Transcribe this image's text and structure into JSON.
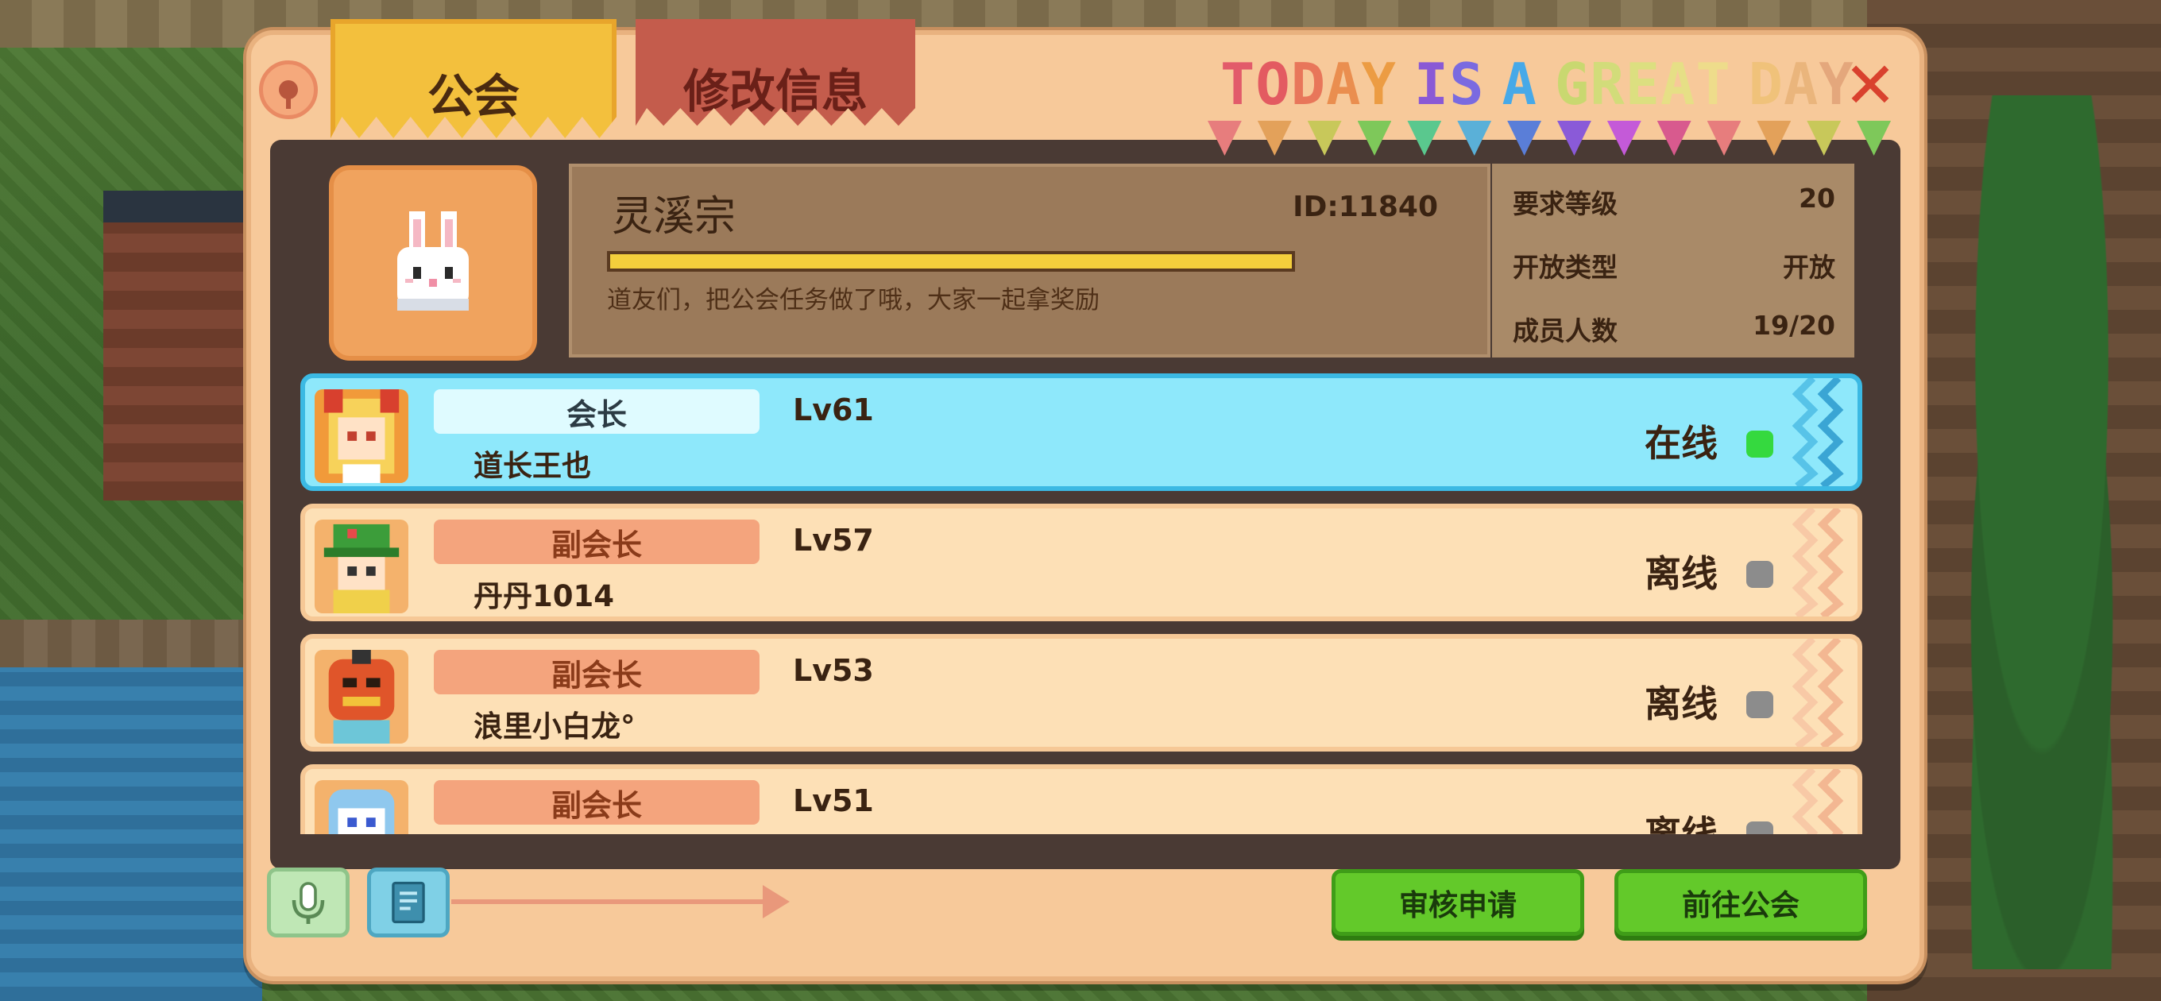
{
  "panel": {
    "tabs": [
      {
        "label": "公会",
        "active": true
      },
      {
        "label": "修改信息",
        "active": false
      }
    ],
    "banner": {
      "letters": [
        {
          "ch": "T",
          "color": "#e25b6a"
        },
        {
          "ch": "O",
          "color": "#e35a61"
        },
        {
          "ch": "D",
          "color": "#e8765a"
        },
        {
          "ch": "A",
          "color": "#ea8e4f"
        },
        {
          "ch": "Y",
          "color": "#ec9c43"
        },
        {
          "ch": " ",
          "color": "#000000"
        },
        {
          "ch": "I",
          "color": "#8a59d5"
        },
        {
          "ch": "S",
          "color": "#7a6ae0"
        },
        {
          "ch": " ",
          "color": "#000000"
        },
        {
          "ch": "A",
          "color": "#47a9e8"
        },
        {
          "ch": " ",
          "color": "#000000"
        },
        {
          "ch": "G",
          "color": "#c9d870"
        },
        {
          "ch": "R",
          "color": "#d2dc7a"
        },
        {
          "ch": "E",
          "color": "#dcdf80"
        },
        {
          "ch": "A",
          "color": "#e6df86"
        },
        {
          "ch": "T",
          "color": "#eedc8b"
        },
        {
          "ch": " ",
          "color": "#000000"
        },
        {
          "ch": "D",
          "color": "#f0c27a"
        },
        {
          "ch": "A",
          "color": "#eab57c"
        },
        {
          "ch": "Y",
          "color": "#e4a77c"
        }
      ],
      "flag_colors": [
        "#e77d7d",
        "#e3a15a",
        "#c8c85a",
        "#7ec85a",
        "#5ac88e",
        "#5ab0d8",
        "#5a7ed8",
        "#8a5ad8",
        "#c45ad8",
        "#d85a8e",
        "#e77d7d",
        "#e3a15a",
        "#c8c85a",
        "#7ec85a"
      ]
    },
    "close_icon": "close-icon",
    "help_icon": "help-icon"
  },
  "guild": {
    "avatar_icon": "rabbit-icon",
    "name": "灵溪宗",
    "id_text": "ID:11840",
    "notice": "道友们，把公会任务做了哦，大家一起拿奖励",
    "stats": [
      {
        "label": "要求等级",
        "value": "20"
      },
      {
        "label": "开放类型",
        "value": "开放"
      },
      {
        "label": "成员人数",
        "value": "19/20"
      }
    ]
  },
  "members": [
    {
      "role": "会长",
      "name": "道长王也",
      "level": "Lv61",
      "status": "在线",
      "online": true,
      "avatar_icon": "fox-girl-avatar"
    },
    {
      "role": "副会长",
      "name": "丹丹1014",
      "level": "Lv57",
      "status": "离线",
      "online": false,
      "avatar_icon": "green-hat-avatar"
    },
    {
      "role": "副会长",
      "name": "浪里小白龙°",
      "level": "Lv53",
      "status": "离线",
      "online": false,
      "avatar_icon": "pumpkin-avatar"
    },
    {
      "role": "副会长",
      "name": "",
      "level": "Lv51",
      "status": "离线",
      "online": false,
      "avatar_icon": "blue-robot-avatar"
    }
  ],
  "bottom": {
    "mic_icon": "microphone-icon",
    "book_icon": "book-icon",
    "buttons": {
      "review": "审核申请",
      "goto_guild": "前往公会"
    }
  },
  "colors": {
    "online": "#35d93f",
    "offline": "#8c8c8c",
    "leader_row": "#8ee8fb",
    "member_row": "#fde0b6",
    "accent_green": "#63c92a"
  }
}
